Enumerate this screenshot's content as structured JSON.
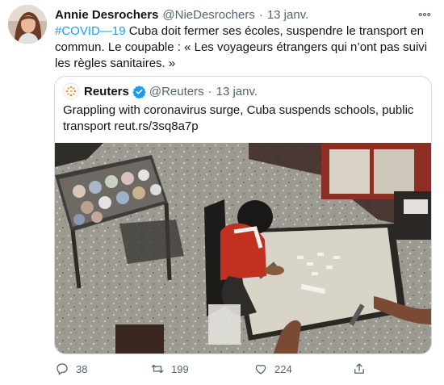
{
  "author": {
    "display_name": "Annie Desrochers",
    "handle": "@NieDesrochers",
    "separator": "·",
    "date": "13 janv."
  },
  "tweet": {
    "hashtag": "#COVID—19",
    "text": " Cuba doit fermer ses écoles, suspendre le transport en commun. Le coupable : « Les voyageurs étrangers qui n’ont pas suivi les règles sanitaires. »"
  },
  "quoted": {
    "display_name": "Reuters",
    "handle": "@Reuters",
    "separator": "·",
    "date": "13 janv.",
    "text": "Grappling with coronavirus surge, Cuba suspends schools, public transport reut.rs/3sq8a7p"
  },
  "actions": {
    "reply_count": "38",
    "retweet_count": "199",
    "like_count": "224"
  },
  "icons": {
    "more": "more-icon",
    "verified": "verified-badge-icon",
    "reply": "reply-icon",
    "retweet": "retweet-icon",
    "like": "heart-icon",
    "share": "share-icon"
  },
  "colors": {
    "link": "#1d9bf0",
    "secondary_text": "#536471",
    "border": "#cfd9de",
    "reuters_orange": "#f28c28"
  }
}
